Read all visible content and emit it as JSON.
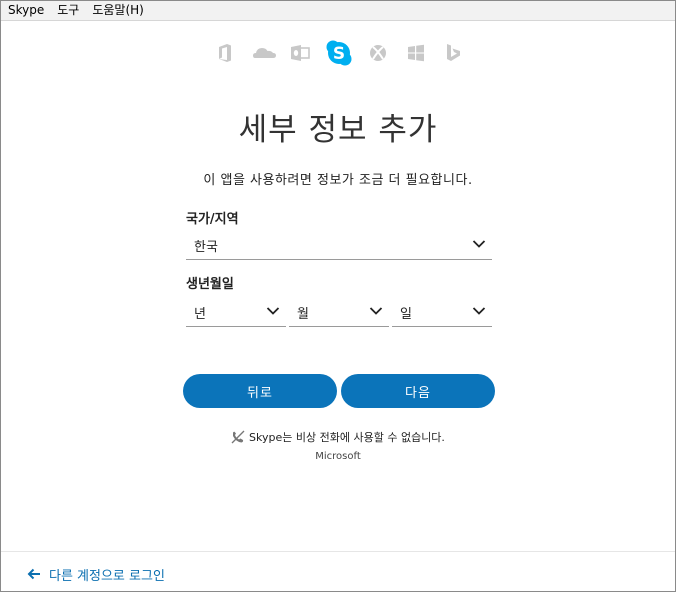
{
  "menu": {
    "items": [
      "Skype",
      "도구",
      "도움말(H)"
    ]
  },
  "app_icons": [
    {
      "name": "office-icon",
      "active": false
    },
    {
      "name": "onedrive-icon",
      "active": false
    },
    {
      "name": "outlook-icon",
      "active": false
    },
    {
      "name": "skype-icon",
      "active": true
    },
    {
      "name": "xbox-icon",
      "active": false
    },
    {
      "name": "windows-icon",
      "active": false
    },
    {
      "name": "bing-icon",
      "active": false
    }
  ],
  "colors": {
    "accent": "#0b74ba",
    "skype": "#00aff0",
    "icon_gray": "#c8c8c8",
    "link": "#0b6fb0"
  },
  "page": {
    "title": "세부 정보 추가",
    "subtitle": "이 앱을 사용하려면 정보가 조금 더 필요합니다."
  },
  "form": {
    "country": {
      "label": "국가/지역",
      "value": "한국"
    },
    "birthdate": {
      "label": "생년월일",
      "year": "년",
      "month": "월",
      "day": "일"
    }
  },
  "buttons": {
    "back": "뒤로",
    "next": "다음"
  },
  "notice": "Skype는 비상 전화에 사용할 수 없습니다.",
  "brand": "Microsoft",
  "footer": {
    "link": "다른 계정으로 로그인"
  }
}
